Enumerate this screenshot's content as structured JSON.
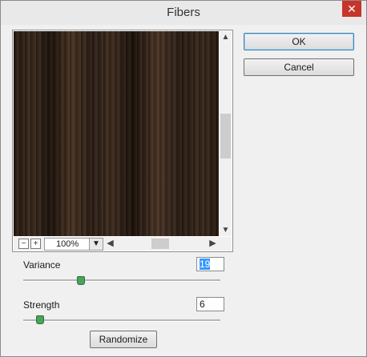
{
  "window": {
    "title": "Fibers",
    "close_label": "✕"
  },
  "buttons": {
    "ok": "OK",
    "cancel": "Cancel",
    "randomize": "Randomize"
  },
  "preview": {
    "zoom_value": "100%",
    "zoom_out_label": "−",
    "zoom_in_label": "+",
    "dropdown_icon": "chevron-down-icon"
  },
  "params": {
    "variance": {
      "label": "Variance",
      "value": "19",
      "min": 1,
      "max": 64,
      "level": 19
    },
    "strength": {
      "label": "Strength",
      "value": "6",
      "min": 1,
      "max": 64,
      "level": 6
    }
  }
}
